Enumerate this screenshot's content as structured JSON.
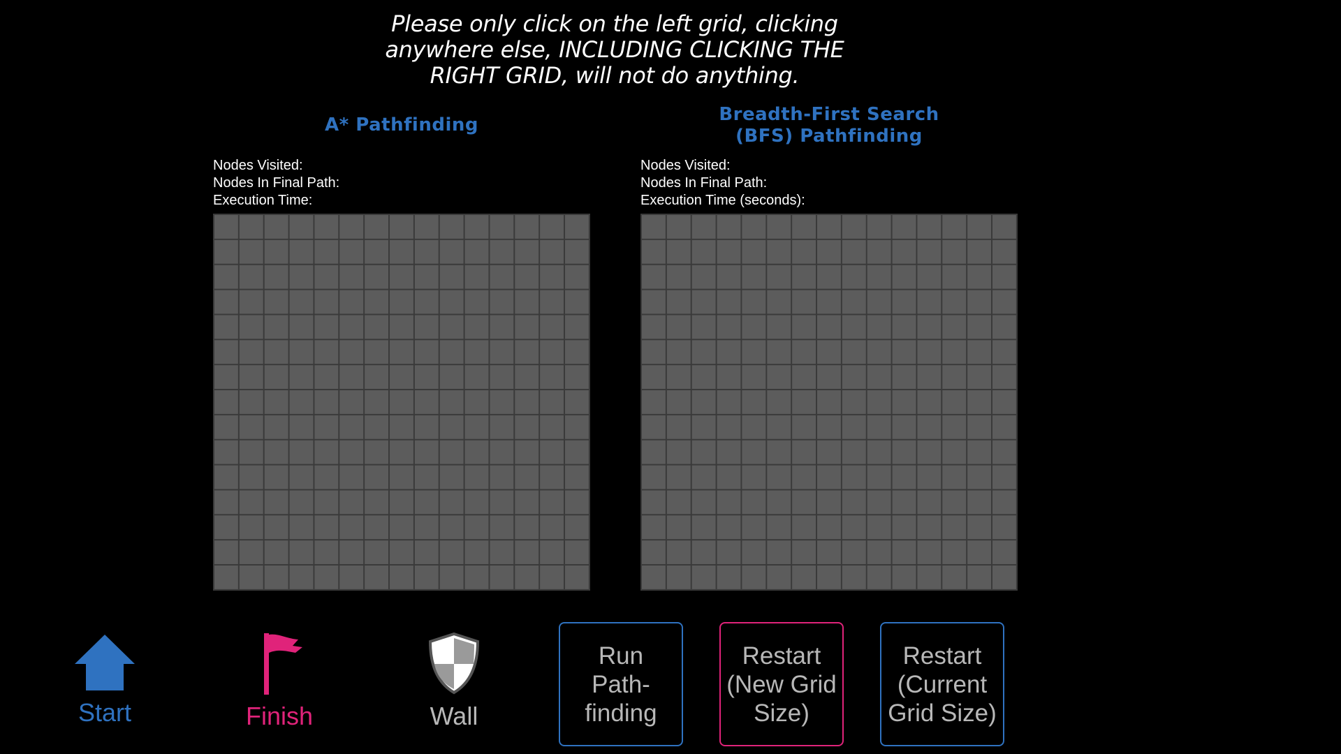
{
  "instruction": {
    "line1": "Please only click on the left grid, clicking",
    "line2": "anywhere else, INCLUDING CLICKING THE",
    "line3": "RIGHT GRID, will not do anything."
  },
  "left_panel": {
    "title": "A* Pathfinding",
    "nodes_visited_label": "Nodes Visited:",
    "nodes_final_label": "Nodes In Final Path:",
    "exec_time_label": "Execution Time:",
    "grid_rows": 15,
    "grid_cols": 15
  },
  "right_panel": {
    "title_line1": "Breadth-First Search",
    "title_line2": "(BFS) Pathfinding",
    "nodes_visited_label": "Nodes Visited:",
    "nodes_final_label": "Nodes In Final Path:",
    "exec_time_label": "Execution Time (seconds):",
    "grid_rows": 15,
    "grid_cols": 15
  },
  "tools": {
    "start": {
      "label": "Start",
      "icon": "home-icon",
      "color": "#2f72c0"
    },
    "finish": {
      "label": "Finish",
      "icon": "flag-icon",
      "color": "#e0237a"
    },
    "wall": {
      "label": "Wall",
      "icon": "shield-icon",
      "color": "#b8b8b8"
    }
  },
  "buttons": {
    "run": {
      "line1": "Run",
      "line2": "Path-",
      "line3": "finding"
    },
    "restart_new": {
      "line1": "Restart",
      "line2": "(New Grid",
      "line3": "Size)"
    },
    "restart_current": {
      "line1": "Restart",
      "line2": "(Current",
      "line3": "Grid Size)"
    }
  },
  "colors": {
    "accent_blue": "#2f72c0",
    "accent_pink": "#e0237a",
    "grid_cell": "#5c5c5c",
    "grid_line": "#3a3a3a"
  }
}
